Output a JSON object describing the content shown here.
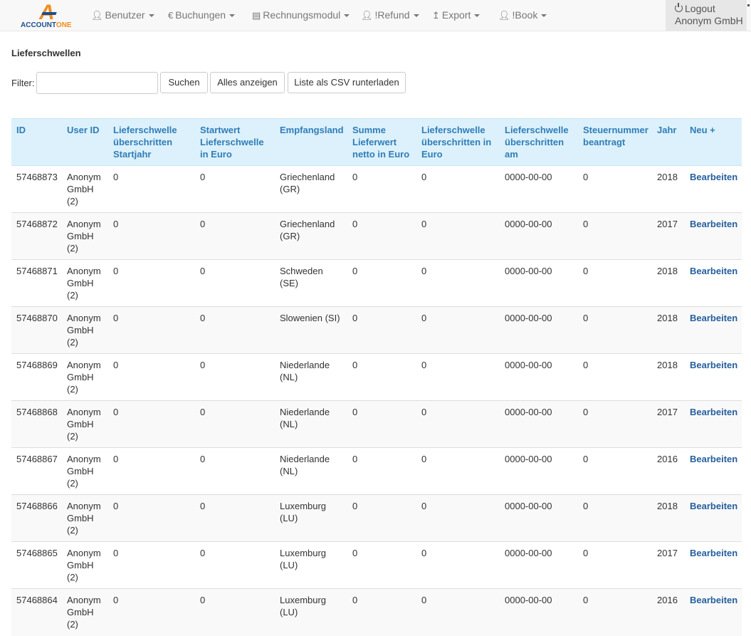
{
  "brand": {
    "logo_letter": "A",
    "logo_text_a": "ACCOUNT",
    "logo_text_b": "ONE",
    "primary": "#1c4f8c",
    "accent": "#f08c1e"
  },
  "nav": {
    "items": [
      {
        "label": "Benutzer",
        "icon": "user-icon"
      },
      {
        "label": "Buchungen",
        "icon": "euro-icon"
      },
      {
        "label": "Rechnungsmodul",
        "icon": "list-icon"
      },
      {
        "label": "!Refund",
        "icon": "user-icon"
      },
      {
        "label": "Export",
        "icon": "upload-icon"
      },
      {
        "label": "!Book",
        "icon": "user-icon"
      }
    ],
    "logout_label": "Logout",
    "account_name": "Anonym GmbH"
  },
  "page": {
    "title": "Lieferschwellen"
  },
  "filter": {
    "label": "Filter:",
    "value": "",
    "search_label": "Suchen",
    "show_all_label": "Alles anzeigen",
    "csv_label": "Liste als CSV runterladen"
  },
  "table": {
    "columns": [
      "ID",
      "User ID",
      "Lieferschwelle überschritten Startjahr",
      "Startwert Lieferschwelle in Euro",
      "Empfangsland",
      "Summe Lieferwert netto in Euro",
      "Lieferschwelle überschritten in Euro",
      "Lieferschwelle überschritten am",
      "Steuernummer beantragt",
      "Jahr",
      "Neu +"
    ],
    "edit_label": "Bearbeiten",
    "rows": [
      {
        "id": "57468873",
        "user": "Anonym GmbH (2)",
        "start_year": "0",
        "start_value": "0",
        "country": "Griechenland (GR)",
        "sum": "0",
        "exceeded_eur": "0",
        "exceeded_at": "0000-00-00",
        "tax_no": "0",
        "year": "2018"
      },
      {
        "id": "57468872",
        "user": "Anonym GmbH (2)",
        "start_year": "0",
        "start_value": "0",
        "country": "Griechenland (GR)",
        "sum": "0",
        "exceeded_eur": "0",
        "exceeded_at": "0000-00-00",
        "tax_no": "0",
        "year": "2017"
      },
      {
        "id": "57468871",
        "user": "Anonym GmbH (2)",
        "start_year": "0",
        "start_value": "0",
        "country": "Schweden (SE)",
        "sum": "0",
        "exceeded_eur": "0",
        "exceeded_at": "0000-00-00",
        "tax_no": "0",
        "year": "2018"
      },
      {
        "id": "57468870",
        "user": "Anonym GmbH (2)",
        "start_year": "0",
        "start_value": "0",
        "country": "Slowenien (SI)",
        "sum": "0",
        "exceeded_eur": "0",
        "exceeded_at": "0000-00-00",
        "tax_no": "0",
        "year": "2018"
      },
      {
        "id": "57468869",
        "user": "Anonym GmbH (2)",
        "start_year": "0",
        "start_value": "0",
        "country": "Niederlande (NL)",
        "sum": "0",
        "exceeded_eur": "0",
        "exceeded_at": "0000-00-00",
        "tax_no": "0",
        "year": "2018"
      },
      {
        "id": "57468868",
        "user": "Anonym GmbH (2)",
        "start_year": "0",
        "start_value": "0",
        "country": "Niederlande (NL)",
        "sum": "0",
        "exceeded_eur": "0",
        "exceeded_at": "0000-00-00",
        "tax_no": "0",
        "year": "2017"
      },
      {
        "id": "57468867",
        "user": "Anonym GmbH (2)",
        "start_year": "0",
        "start_value": "0",
        "country": "Niederlande (NL)",
        "sum": "0",
        "exceeded_eur": "0",
        "exceeded_at": "0000-00-00",
        "tax_no": "0",
        "year": "2016"
      },
      {
        "id": "57468866",
        "user": "Anonym GmbH (2)",
        "start_year": "0",
        "start_value": "0",
        "country": "Luxemburg (LU)",
        "sum": "0",
        "exceeded_eur": "0",
        "exceeded_at": "0000-00-00",
        "tax_no": "0",
        "year": "2018"
      },
      {
        "id": "57468865",
        "user": "Anonym GmbH (2)",
        "start_year": "0",
        "start_value": "0",
        "country": "Luxemburg (LU)",
        "sum": "0",
        "exceeded_eur": "0",
        "exceeded_at": "0000-00-00",
        "tax_no": "0",
        "year": "2017"
      },
      {
        "id": "57468864",
        "user": "Anonym GmbH (2)",
        "start_year": "0",
        "start_value": "0",
        "country": "Luxemburg (LU)",
        "sum": "0",
        "exceeded_eur": "0",
        "exceeded_at": "0000-00-00",
        "tax_no": "0",
        "year": "2016"
      }
    ]
  }
}
